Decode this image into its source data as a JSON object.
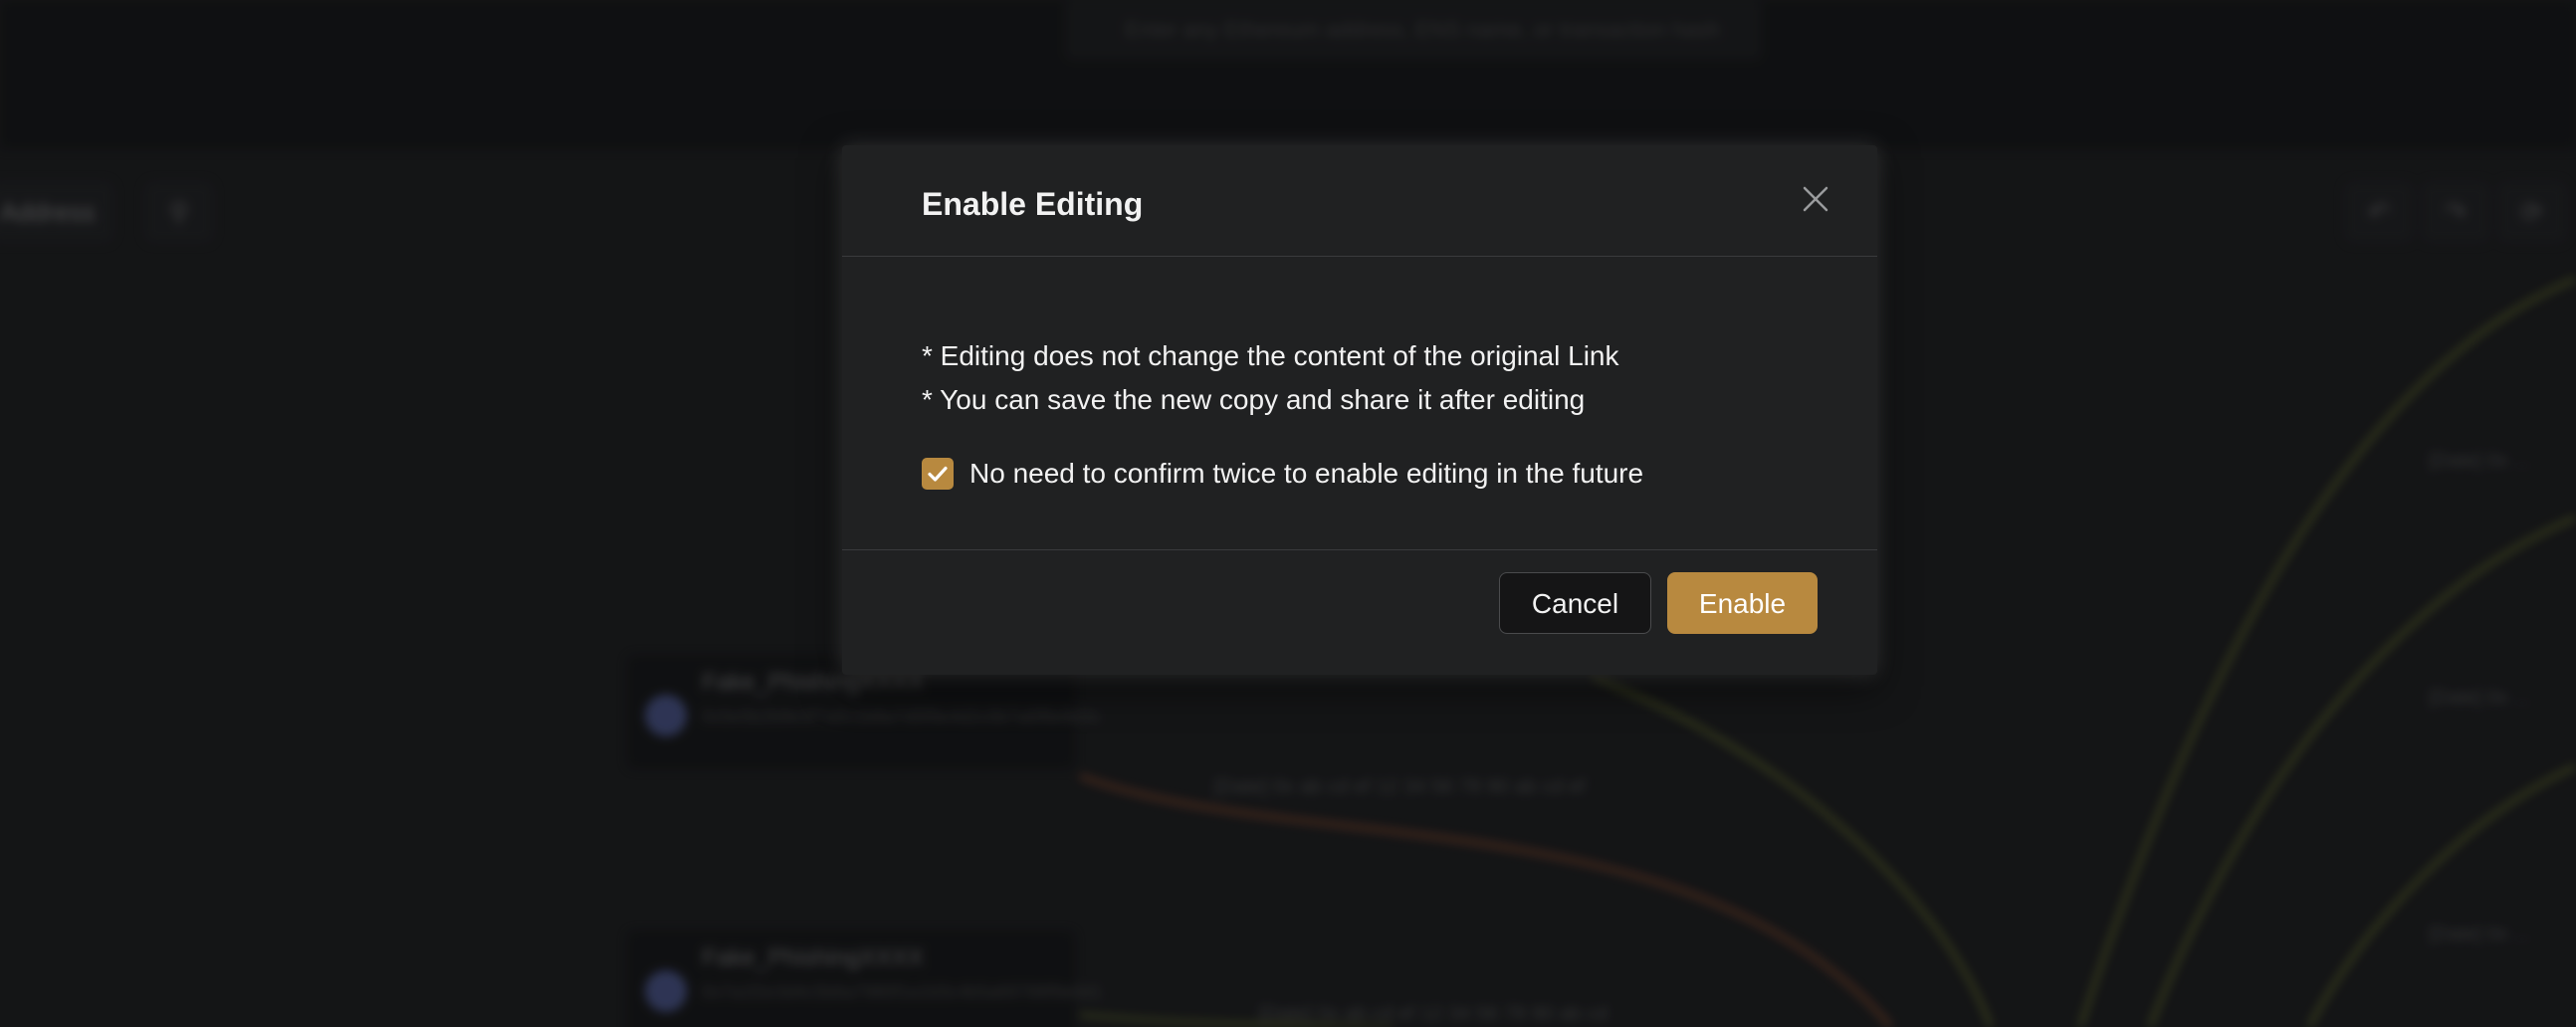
{
  "background": {
    "search_placeholder": "Enter any Ethereum address, ENS name, or transaction hash",
    "address_tab": "Address",
    "search_icon": "search-icon",
    "toolbar_icons": [
      "undo-icon",
      "redo-icon",
      "refresh-icon"
    ],
    "nodes": [
      {
        "title": "Fake_PhishingXXXX",
        "subtitle": "0x5e5b2b9e3f7a0c1b8a7d5f9e4d2c0b7a6f8e9d3c"
      },
      {
        "title": "Fake_PhishingXXXX",
        "subtitle": "0x7a1f2e3d4c5b6a7980f1e2d3c4b5a69788f9e0d1"
      }
    ],
    "edge_labels": [
      "[Date] 0x ab cd ef 12 34 56 78 90 ab cd ef",
      "[Date] 0x ab cd ef 12 34 56 78 90 ab cd"
    ],
    "right_labels": [
      "[Date] 0x ...",
      "[Date] 0x ...",
      "[Date] 0x ..."
    ],
    "colors": {
      "wire_green": "#6f7a2c",
      "wire_orange": "#8a4a2c",
      "node_avatar": "#5b6ab5"
    }
  },
  "modal": {
    "title": "Enable Editing",
    "close_icon": "close-icon",
    "notes": [
      "* Editing does not change the content of the original Link",
      "* You can save the new copy and share it after editing"
    ],
    "checkbox": {
      "checked": true,
      "label": "No need to confirm twice to enable editing in the future",
      "icon": "checkmark-icon"
    },
    "buttons": {
      "cancel": "Cancel",
      "enable": "Enable"
    },
    "colors": {
      "accent": "#b8893f",
      "surface": "#202122",
      "text": "#f2f2f2"
    }
  }
}
